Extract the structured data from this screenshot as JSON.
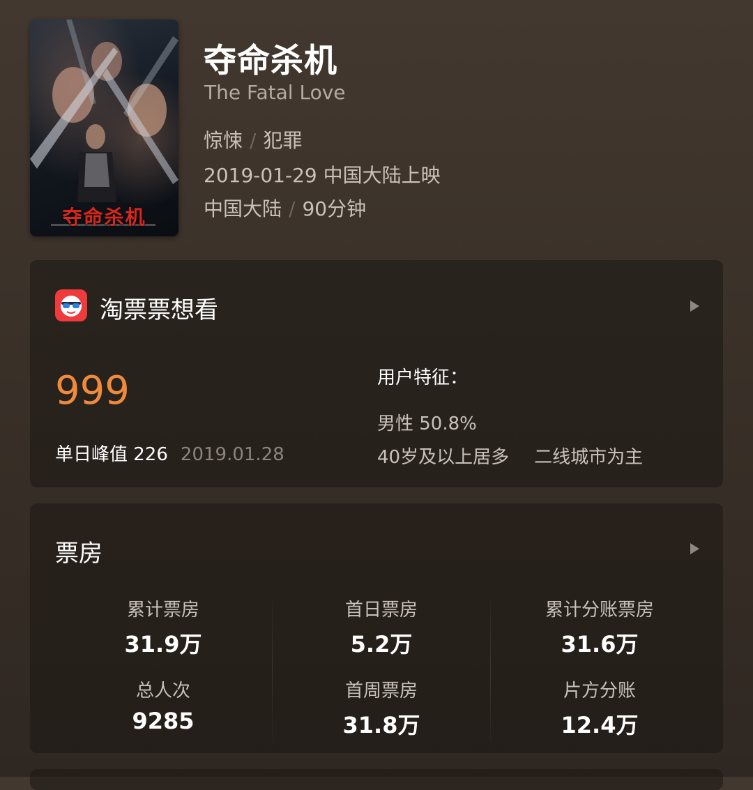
{
  "movie": {
    "poster_title": "夺命杀机",
    "title": "夺命杀机",
    "english_title": "The Fatal Love",
    "genres": [
      "惊悚",
      "犯罪"
    ],
    "release": "2019-01-29 中国大陆上映",
    "region": "中国大陆",
    "duration": "90分钟",
    "separator": "/"
  },
  "wish": {
    "title": "淘票票想看",
    "logo_icon": "taopiaopiao-logo-icon",
    "count": "999",
    "peak_label": "单日峰值 226",
    "peak_date": "2019.01.28",
    "features_title": "用户特征：",
    "gender": "男性 50.8%",
    "age": "40岁及以上居多",
    "city": "二线城市为主"
  },
  "box_office": {
    "title": "票房",
    "stats": [
      {
        "label": "累计票房",
        "value": "31.9万"
      },
      {
        "label": "首日票房",
        "value": "5.2万"
      },
      {
        "label": "累计分账票房",
        "value": "31.6万"
      },
      {
        "label": "总人次",
        "value": "9285"
      },
      {
        "label": "首周票房",
        "value": "31.8万"
      },
      {
        "label": "片方分账",
        "value": "12.4万"
      }
    ]
  },
  "colors": {
    "accent_orange": "#f08a3c",
    "logo_red": "#ef3b3b",
    "poster_title_red": "#d9271c"
  }
}
